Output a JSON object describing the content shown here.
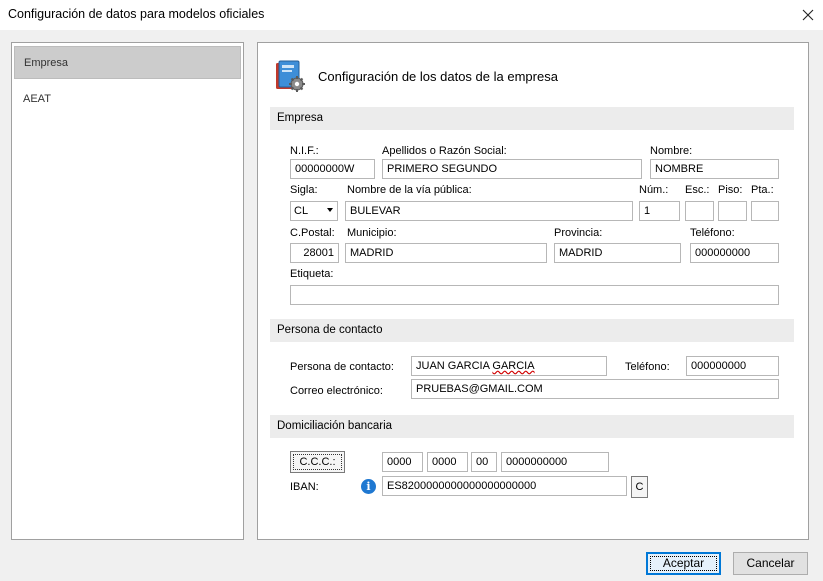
{
  "window": {
    "title": "Configuración de datos para modelos oficiales"
  },
  "sidebar": {
    "items": [
      {
        "label": "Empresa"
      },
      {
        "label": "AEAT"
      }
    ]
  },
  "header": {
    "title": "Configuración de los datos de la empresa",
    "icon": "book-gear-icon"
  },
  "empresa": {
    "section_title": "Empresa",
    "nif_label": "N.I.F.:",
    "nif": "00000000W",
    "razon_label": "Apellidos o Razón Social:",
    "razon": "PRIMERO SEGUNDO",
    "nombre_label": "Nombre:",
    "nombre": "NOMBRE",
    "sigla_label": "Sigla:",
    "sigla": "CL",
    "via_label": "Nombre de la vía pública:",
    "via": "BULEVAR",
    "num_label": "Núm.:",
    "num": "1",
    "esc_label": "Esc.:",
    "esc": "",
    "piso_label": "Piso:",
    "piso": "",
    "pta_label": "Pta.:",
    "pta": "",
    "cp_label": "C.Postal:",
    "cp": "28001",
    "municipio_label": "Municipio:",
    "municipio": "MADRID",
    "provincia_label": "Provincia:",
    "provincia": "MADRID",
    "telefono_label": "Teléfono:",
    "telefono": "000000000",
    "etiqueta_label": "Etiqueta:",
    "etiqueta": ""
  },
  "contacto": {
    "section_title": "Persona de contacto",
    "persona_label": "Persona de contacto:",
    "persona_first": "JUAN GARCIA ",
    "persona_second": "GARCIA",
    "telefono_label": "Teléfono:",
    "telefono": "000000000",
    "correo_label": "Correo electrónico:",
    "correo": "PRUEBAS@GMAIL.COM"
  },
  "banco": {
    "section_title": "Domiciliación bancaria",
    "ccc_button": "C.C.C.:",
    "ccc_entidad": "0000",
    "ccc_oficina": "0000",
    "ccc_dc": "00",
    "ccc_cuenta": "0000000000",
    "iban_label": "IBAN:",
    "iban": "ES8200000000000000000000",
    "iban_button": "C"
  },
  "buttons": {
    "accept": "Aceptar",
    "cancel": "Cancelar"
  }
}
